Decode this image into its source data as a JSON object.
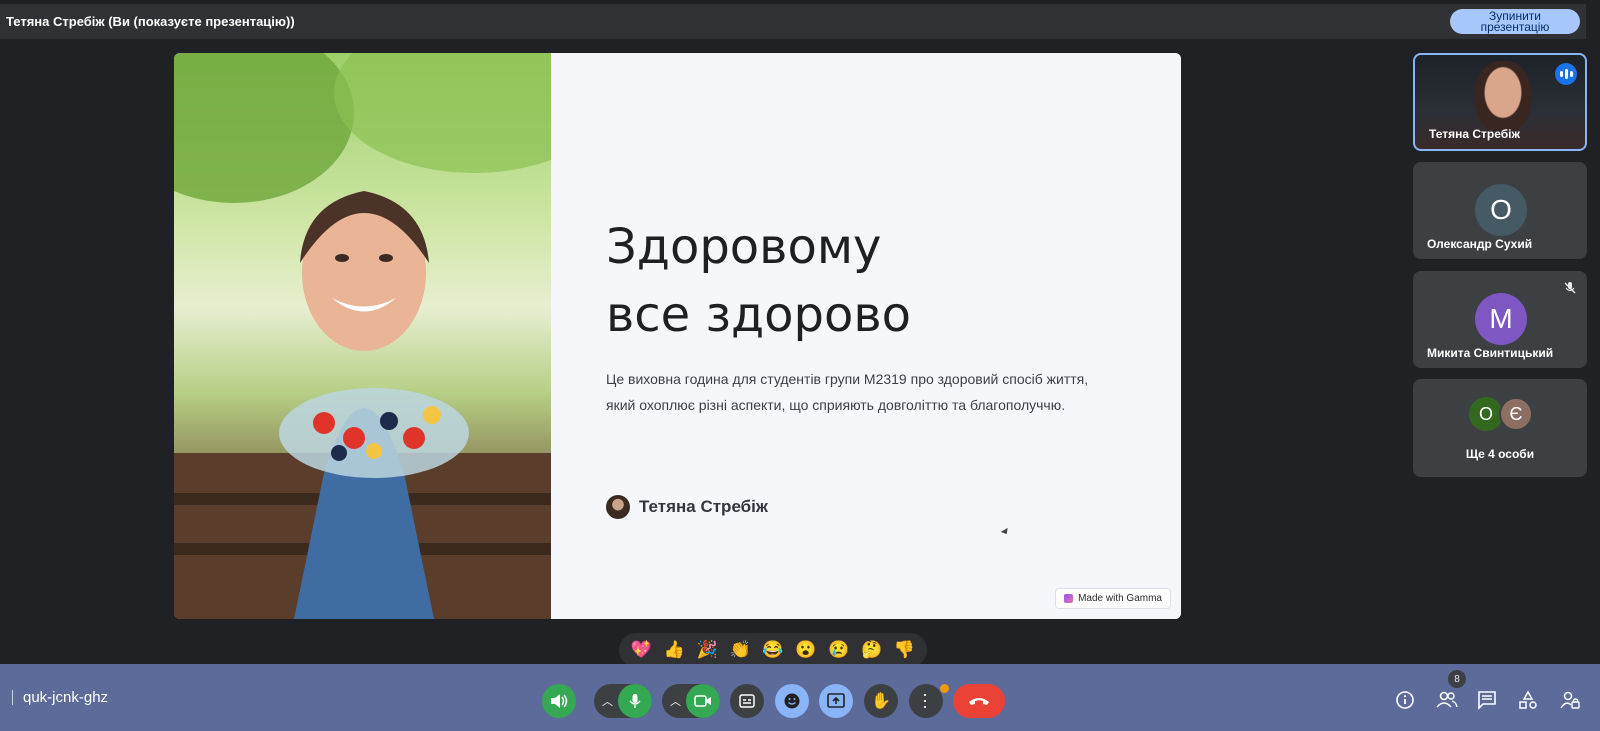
{
  "topbar": {
    "title": "Тетяна Стребіж (Ви (показуєте презентацію))",
    "stop_button": "Зупинити презентацію"
  },
  "slide": {
    "title_line1": "Здоровому",
    "title_line2": "все здорово",
    "desc_line1": "Це виховна година для студентів групи М2319 про здоровий спосіб життя,",
    "desc_line2": " який охоплює різні аспекти, що сприяють довголіттю та благополуччю.",
    "author": "Тетяна Стребіж",
    "badge": "Made with Gamma"
  },
  "participants": [
    {
      "name": "Тетяна Стребіж",
      "type": "video",
      "speaking": true
    },
    {
      "name": "Олександр Сухий",
      "initial": "О",
      "color": "#455a64"
    },
    {
      "name": "Микита Свинтицький",
      "initial": "М",
      "color": "#7e57c2",
      "muted": true
    },
    {
      "name": "Ще 4 особи",
      "initials": [
        "О",
        "Є"
      ],
      "colors": [
        "#33691e",
        "#8d6e63"
      ]
    }
  ],
  "reactions": [
    "💖",
    "👍",
    "🎉",
    "👏",
    "😂",
    "😮",
    "😢",
    "🤔",
    "👎"
  ],
  "bottombar": {
    "meeting_code": "quk-jcnk-ghz",
    "participants_count": "8"
  },
  "colors": {
    "accent": "#8ab4f8",
    "bottombar": "#5d6b9a",
    "end_call": "#ea4335"
  }
}
